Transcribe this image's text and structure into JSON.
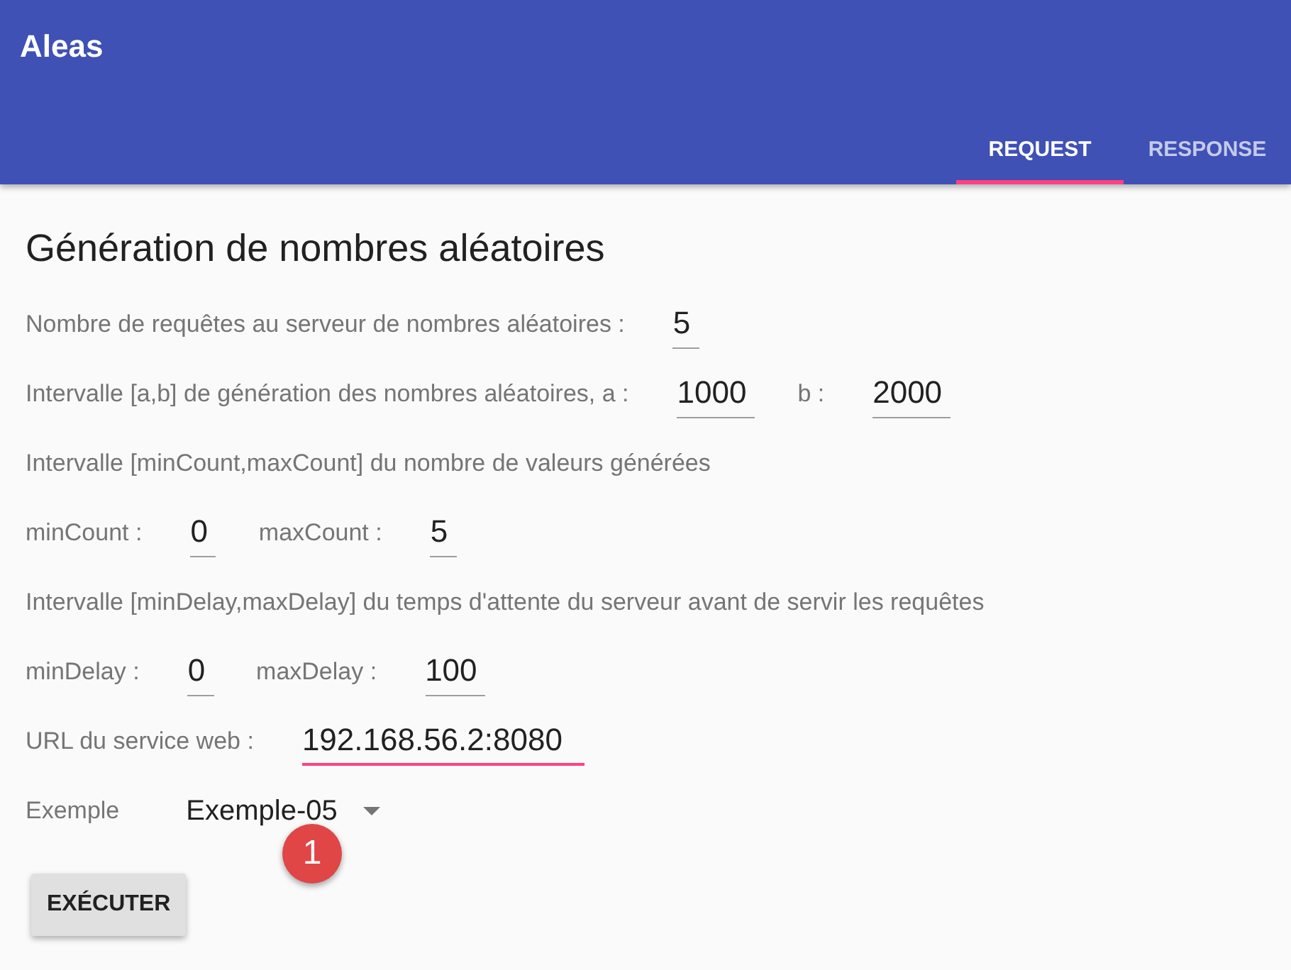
{
  "app_bar": {
    "title": "Aleas"
  },
  "tabs": [
    {
      "label": "REQUEST",
      "selected": true
    },
    {
      "label": "RESPONSE",
      "selected": false
    }
  ],
  "form": {
    "heading": "Génération de nombres aléatoires",
    "rows": [
      {
        "kind": "fields",
        "items": [
          {
            "label": "Nombre de requêtes au serveur de nombres aléatoires :",
            "value": "5",
            "focused": false
          }
        ]
      },
      {
        "kind": "fields",
        "items": [
          {
            "label": "Intervalle [a,b] de génération des nombres aléatoires, a :",
            "value": "1000",
            "focused": false
          },
          {
            "label": "b :",
            "value": "2000",
            "focused": false
          }
        ]
      },
      {
        "kind": "text",
        "text": "Intervalle [minCount,maxCount] du nombre de valeurs générées"
      },
      {
        "kind": "fields",
        "items": [
          {
            "label": "minCount :",
            "value": "0",
            "focused": false
          },
          {
            "label": "maxCount :",
            "value": "5",
            "focused": false
          }
        ]
      },
      {
        "kind": "text",
        "text": "Intervalle [minDelay,maxDelay] du temps d'attente du serveur avant de servir les requêtes"
      },
      {
        "kind": "fields",
        "items": [
          {
            "label": "minDelay :",
            "value": "0",
            "focused": false
          },
          {
            "label": "maxDelay :",
            "value": "100",
            "focused": false
          }
        ]
      },
      {
        "kind": "fields",
        "items": [
          {
            "label": "URL du service web :",
            "value": "192.168.56.2:8080",
            "focused": true
          }
        ]
      },
      {
        "kind": "select",
        "label": "Exemple",
        "value": "Exemple-05"
      }
    ],
    "button": "EXÉCUTER"
  },
  "annotation": {
    "text": "1"
  }
}
